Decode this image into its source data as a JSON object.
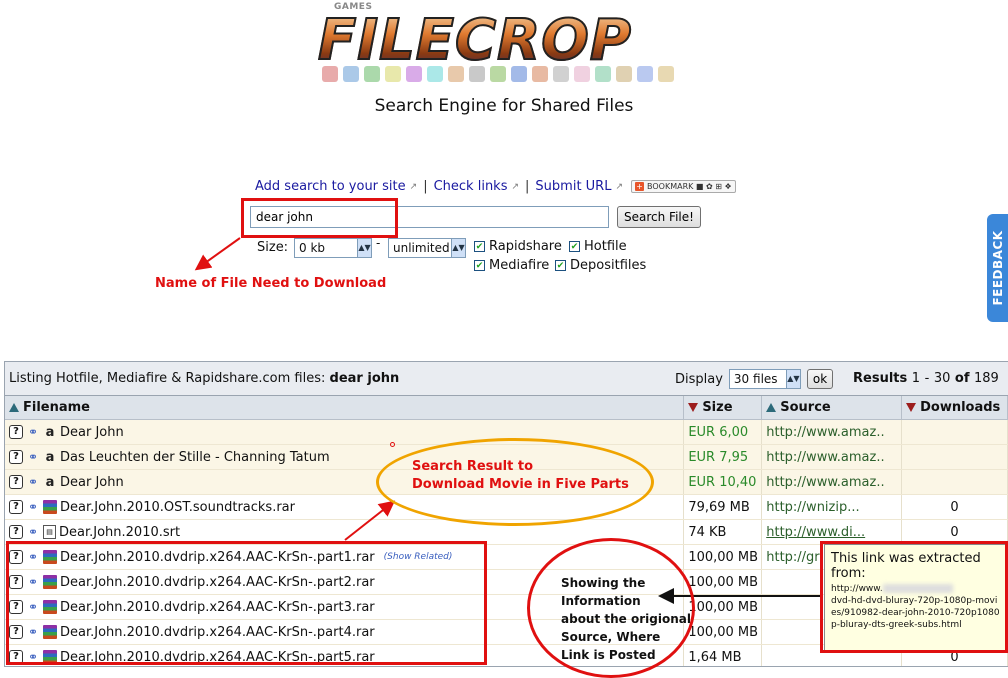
{
  "logo": {
    "games_label": "GAMES",
    "brand": "FILECROP"
  },
  "tagline": "Search Engine for Shared Files",
  "links": [
    {
      "label": "Add search to your site"
    },
    {
      "label": "Check links"
    },
    {
      "label": "Submit URL"
    }
  ],
  "bookmark_label": "BOOKMARK",
  "search": {
    "value": "dear john",
    "button": "Search File!"
  },
  "size_filter": {
    "label": "Size:",
    "min": "0 kb",
    "max": "unlimited",
    "separator": "-"
  },
  "hosts": [
    {
      "label": "Rapidshare",
      "checked": true
    },
    {
      "label": "Hotfile",
      "checked": true
    },
    {
      "label": "Mediafire",
      "checked": true
    },
    {
      "label": "Depositfiles",
      "checked": true
    }
  ],
  "annotations": {
    "file_name": "Name of File Need to Download",
    "search_result_line1": "Search Result to",
    "search_result_line2": "Download Movie in Five Parts",
    "source_line1": "Showing the",
    "source_line2": "Information",
    "source_line3": "about the origional",
    "source_line4": "Source, Where",
    "source_line5": "Link is Posted"
  },
  "feedback_label": "FEEDBACK",
  "results": {
    "listing_prefix": "Listing Hotfile, Mediafire & Rapidshare.com files:",
    "query": "dear john",
    "display_label": "Display",
    "display_value": "30 files",
    "ok_label": "ok",
    "results_label": "Results",
    "range_start": "1",
    "range_sep": "-",
    "range_end": "30",
    "of_label": "of",
    "total": "189",
    "columns": {
      "filename": "Filename",
      "size": "Size",
      "source": "Source",
      "downloads": "Downloads"
    },
    "rows": [
      {
        "icon": "amazon-icon",
        "name": "Dear John",
        "size": "EUR 6,00",
        "source": "http://www.amaz..",
        "downloads": ""
      },
      {
        "icon": "amazon-icon",
        "name": "Das Leuchten der Stille - Channing Tatum",
        "size": "EUR 7,95",
        "source": "http://www.amaz..",
        "downloads": ""
      },
      {
        "icon": "amazon-icon",
        "name": "Dear John",
        "size": "EUR 10,40",
        "source": "http://www.amaz..",
        "downloads": ""
      },
      {
        "icon": "rar-icon",
        "name": "Dear.John.2010.OST.soundtracks.rar",
        "size": "79,69 MB",
        "source": "http://wnizip...",
        "downloads": "0"
      },
      {
        "icon": "srt-icon",
        "name": "Dear.John.2010.srt",
        "size": "74 KB",
        "source": "http://www.di...",
        "downloads": "0"
      },
      {
        "icon": "rar-icon",
        "name": "Dear.John.2010.dvdrip.x264.AAC-KrSn-.part1.rar",
        "size": "100,00 MB",
        "source": "http://gr",
        "downloads": "",
        "related": "(Show Related)"
      },
      {
        "icon": "rar-icon",
        "name": "Dear.John.2010.dvdrip.x264.AAC-KrSn-.part2.rar",
        "size": "100,00 MB",
        "source": "",
        "downloads": ""
      },
      {
        "icon": "rar-icon",
        "name": "Dear.John.2010.dvdrip.x264.AAC-KrSn-.part3.rar",
        "size": "100,00 MB",
        "source": "",
        "downloads": ""
      },
      {
        "icon": "rar-icon",
        "name": "Dear.John.2010.dvdrip.x264.AAC-KrSn-.part4.rar",
        "size": "100,00 MB",
        "source": "",
        "downloads": ""
      },
      {
        "icon": "rar-icon",
        "name": "Dear.John.2010.dvdrip.x264.AAC-KrSn-.part5.rar",
        "size": "1,64 MB",
        "source": "",
        "downloads": "0"
      }
    ]
  },
  "tooltip": {
    "title": "This link was extracted from:",
    "url_prefix": "http://www.",
    "url_rest": "dvd-hd-dvd-bluray-720p-1080p-movies/910982-dear-john-2010-720p1080p-bluray-dts-greek-subs.html"
  }
}
